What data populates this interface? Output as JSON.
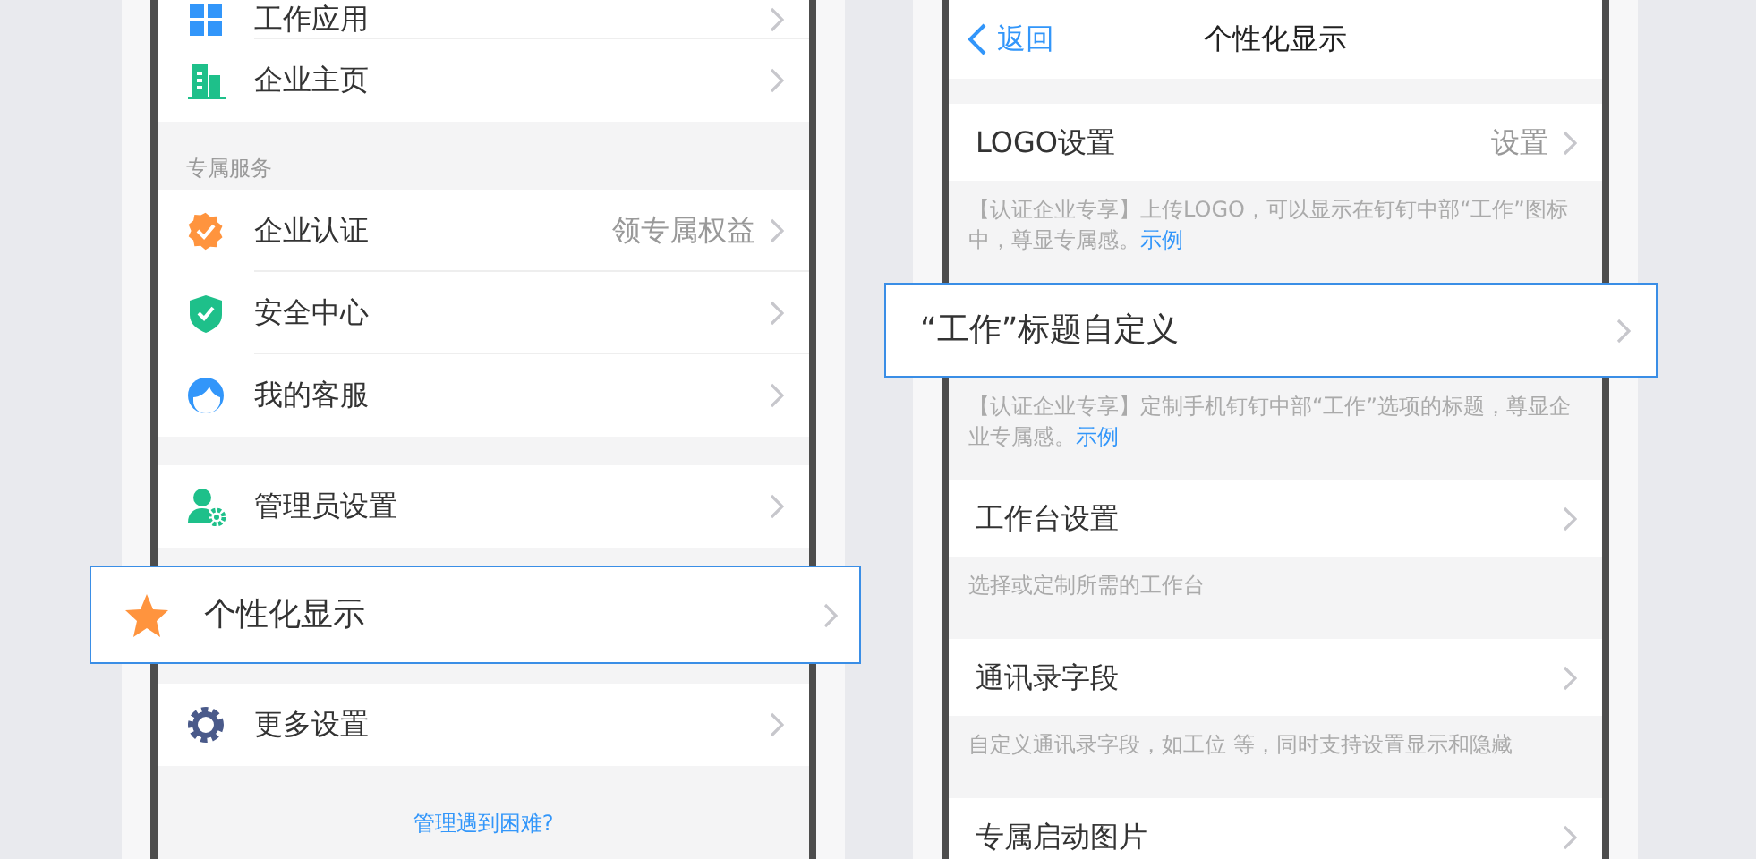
{
  "left_screen": {
    "items": [
      {
        "kind": "row",
        "label": "工作应用"
      },
      {
        "kind": "row",
        "label": "企业主页"
      },
      {
        "kind": "header",
        "label": "专属服务"
      },
      {
        "kind": "row",
        "label": "企业认证",
        "value": "领专属权益"
      },
      {
        "kind": "row",
        "label": "安全中心"
      },
      {
        "kind": "row",
        "label": "我的客服"
      },
      {
        "kind": "spacer"
      },
      {
        "kind": "row",
        "label": "管理员设置"
      },
      {
        "kind": "highlight",
        "label": "个性化显示"
      },
      {
        "kind": "row",
        "label": "更多设置"
      },
      {
        "kind": "link",
        "label": "管理遇到困难?"
      }
    ]
  },
  "right_screen": {
    "nav": {
      "back": "返回",
      "title": "个性化显示"
    },
    "items": [
      {
        "kind": "row",
        "label": "LOGO设置",
        "value": "设置",
        "description": "【认证企业专享】上传LOGO，可以显示在钉钉中部“工作”图标中，尊显专属感。",
        "link": "示例"
      },
      {
        "kind": "highlight",
        "label": "“工作”标题自定义",
        "description": "【认证企业专享】定制手机钉钉中部“工作”选项的标题，尊显企业专属感。",
        "link": "示例"
      },
      {
        "kind": "row",
        "label": "工作台设置",
        "description": "选择或定制所需的工作台"
      },
      {
        "kind": "row",
        "label": "通讯录字段",
        "description": "自定义通讯录字段，如工位 等，同时支持设置显示和隐藏"
      },
      {
        "kind": "row",
        "label": "专属启动图片"
      }
    ]
  }
}
